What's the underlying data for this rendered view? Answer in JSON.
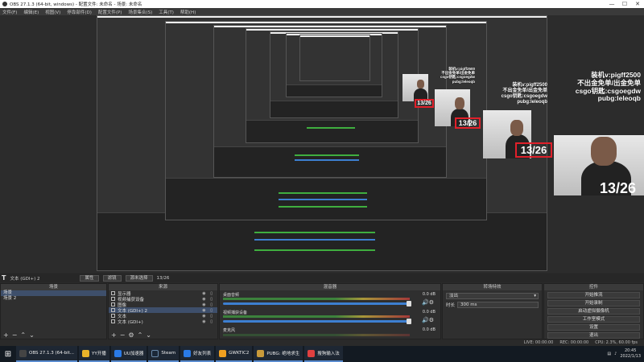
{
  "window": {
    "title": "OBS 27.1.3 (64-bit, windows) - 配置文件: 未命名 - 场景: 未命名",
    "minimize": "—",
    "maximize": "☐",
    "close": "✕"
  },
  "menu": [
    "文件(F)",
    "编辑(E)",
    "视图(V)",
    "停靠部件(D)",
    "配置文件(P)",
    "场景集合(S)",
    "工具(T)",
    "帮助(H)"
  ],
  "overlay": {
    "lines": [
      "装机v:pigff2500",
      "不出金免单/出金免单",
      "csgo钥匙:csgoegdw",
      "pubg:leleoqb"
    ],
    "counter": "13/26",
    "counter_color": "#e0202a"
  },
  "scene_bar": {
    "icon": "T",
    "label": "文本 (GDI+) 2",
    "properties": "属性",
    "filters": "滤镜",
    "text_label": "源未选择",
    "text_value": "13/26"
  },
  "scenes_panel": {
    "title": "场景",
    "items": [
      "场景",
      "场景 2"
    ],
    "selected_index": 0
  },
  "sources_panel": {
    "title": "来源",
    "items": [
      "显示器",
      "视频捕获设备",
      "图像",
      "文本 (GDI+) 2",
      "文本",
      "文本 (GDI+)"
    ],
    "selected_index": 3
  },
  "mixer_panel": {
    "title": "混音器",
    "channels": [
      {
        "name": "桌面音频",
        "db": "0.0 dB",
        "level": 0.62
      },
      {
        "name": "视频捕获设备",
        "db": "0.0 dB",
        "level": 0.55
      },
      {
        "name": "麦克风",
        "db": "0.0 dB",
        "level": 0.1
      }
    ]
  },
  "transitions_panel": {
    "title": "转场特效",
    "type": "淡出",
    "duration_label": "时长",
    "duration": "300 ms"
  },
  "controls_panel": {
    "title": "控件",
    "buttons": [
      "开始推流",
      "开始录制",
      "启动虚拟摄像机",
      "工作室模式",
      "设置",
      "退出"
    ]
  },
  "status": {
    "live": "LIVE: 00:00:00",
    "rec": "REC: 00:00:00",
    "cpu": "CPU: 2.3%, 60.00 fps"
  },
  "taskbar": {
    "start_icon": "windows-icon",
    "tasks": [
      {
        "label": "OBS 27.1.3 (64-bit...",
        "color": "#444"
      },
      {
        "label": "YY开播",
        "color": "#e8b32a"
      },
      {
        "label": "UU加速器",
        "color": "#2a7be8"
      },
      {
        "label": "Steam",
        "color": "#1b2838"
      },
      {
        "label": "好友列表",
        "color": "#2a7be8"
      },
      {
        "label": "GWKTIC2",
        "color": "#f0a020"
      },
      {
        "label": "PUBG: 绝地求生",
        "color": "#c89a3a"
      },
      {
        "label": "搜狗输入法",
        "color": "#e04040"
      }
    ],
    "time": "20:45",
    "date": "2022/1/13"
  }
}
